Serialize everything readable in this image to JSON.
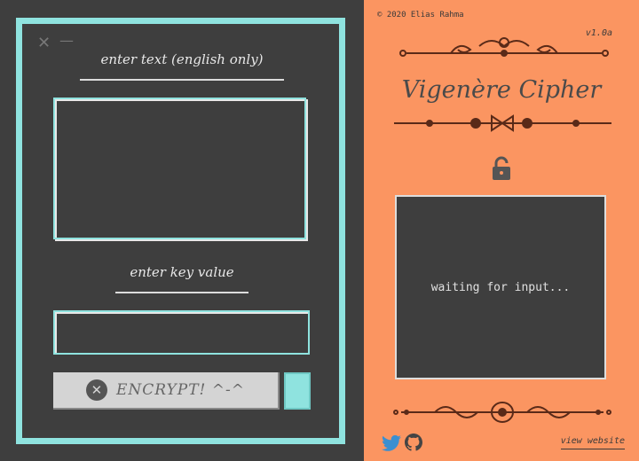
{
  "form": {
    "text_label": "enter text (english only)",
    "key_label": "enter key value",
    "text_value": "",
    "key_value": "",
    "encrypt_label": "ENCRYPT! ^-^",
    "cancel_symbol": "✕",
    "close_symbol": "✕",
    "minimize_symbol": "—"
  },
  "info": {
    "copyright": "© 2020 Elias Rahma",
    "version": "v1.0a",
    "title": "Vigenère Cipher",
    "output_placeholder": "waiting for input...",
    "view_website": "view website"
  },
  "icons": [
    "lock-icon",
    "twitter-icon",
    "github-icon"
  ],
  "colors": {
    "accent_cyan": "#8fe3df",
    "panel_orange": "#fb9561",
    "dark_bg": "#3e3e3e"
  }
}
